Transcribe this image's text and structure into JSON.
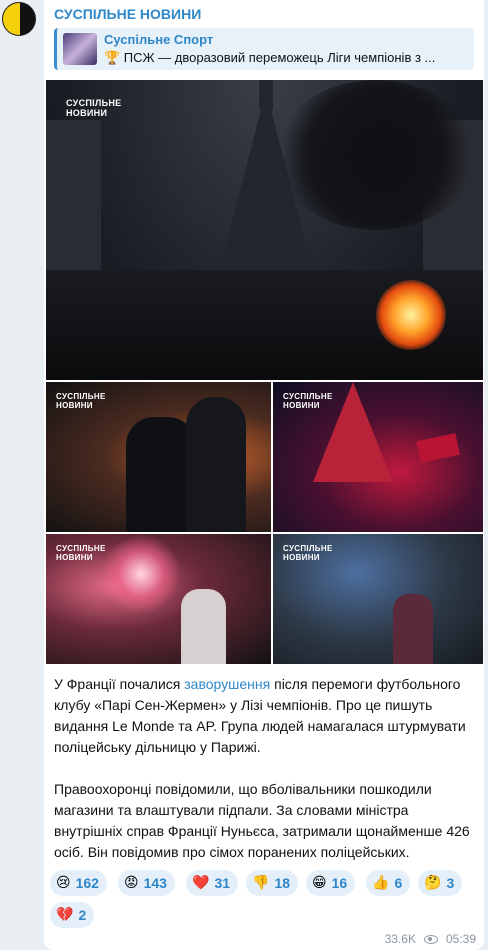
{
  "channel": {
    "name": "СУСПІЛЬНЕ НОВИНИ"
  },
  "reply": {
    "title": "Суспільне Спорт",
    "text": "🏆 ПСЖ — дворазовий переможець Ліги чемпіонів з ..."
  },
  "photos": {
    "watermark": "СУСПІЛЬНЕ\nНОВИНИ"
  },
  "message": {
    "para1_before": "У Франції почалися ",
    "para1_link": "заворушення",
    "para1_after": " після перемоги футбольного клубу «Парі Сен-Жермен» у Лізі чемпіонів. Про це пишуть видання Le Monde та AP. Група людей намагалася штурмувати поліцейську дільницю у Парижі.",
    "para2": "Правоохоронці повідомили, що вболівальники пошкодили магазини та влаштували підпали. За словами міністра внутрішніх справ Франції Нуньєса, затримали щонайменше 426 осіб. Він повідомив про сімох поранених поліцейських."
  },
  "reactions": [
    {
      "icon": "crying-face-icon",
      "emoji": "😢",
      "count": "162"
    },
    {
      "icon": "angry-face-icon",
      "emoji": "😡",
      "count": "143"
    },
    {
      "icon": "red-heart-icon",
      "emoji": "❤️",
      "count": "31"
    },
    {
      "icon": "thumbs-down-icon",
      "emoji": "👎",
      "count": "18"
    },
    {
      "icon": "grinning-face-icon",
      "emoji": "😁",
      "count": "16"
    },
    {
      "icon": "thumbs-up-icon",
      "emoji": "👍",
      "count": "6"
    },
    {
      "icon": "thinking-face-icon",
      "emoji": "🤔",
      "count": "3"
    },
    {
      "icon": "broken-heart-icon",
      "emoji": "💔",
      "count": "2"
    }
  ],
  "meta": {
    "views": "33.6K",
    "time": "05:39"
  }
}
